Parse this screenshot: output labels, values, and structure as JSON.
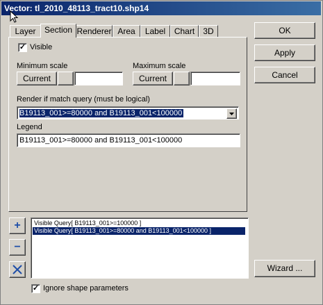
{
  "window": {
    "title": "Vector: tl_2010_48113_tract10.shp14"
  },
  "tabs": [
    {
      "label": "Layer"
    },
    {
      "label": "Section"
    },
    {
      "label": "Renderer"
    },
    {
      "label": "Area"
    },
    {
      "label": "Label"
    },
    {
      "label": "Chart"
    },
    {
      "label": "3D"
    }
  ],
  "active_tab": "Section",
  "section": {
    "visible_label": "Visible",
    "visible_checked": true,
    "min_scale": {
      "label": "Minimum scale",
      "button": "Current",
      "value": ""
    },
    "max_scale": {
      "label": "Maximum scale",
      "button": "Current",
      "value": ""
    },
    "query_label": "Render if match query (must be logical)",
    "query_value": "B19113_001>=80000 and B19113_001<100000",
    "legend_label": "Legend",
    "legend_value": "B19113_001>=80000 and B19113_001<100000"
  },
  "side_buttons": {
    "ok": "OK",
    "apply": "Apply",
    "cancel": "Cancel",
    "wizard": "Wizard ..."
  },
  "list_buttons": {
    "add": "+",
    "remove": "−"
  },
  "query_list": [
    {
      "text": "Visible Query[ B19113_001>=100000 ]",
      "selected": false
    },
    {
      "text": "Visible Query[ B19113_001>=80000 and B19113_001<100000 ]",
      "selected": true
    }
  ],
  "ignore_shape": {
    "label": "Ignore shape parameters",
    "checked": true
  },
  "colors": {
    "title_start": "#0a246a",
    "title_end": "#3a6ea5",
    "selection": "#0a246a",
    "face": "#d4d0c8",
    "accent_blue": "#1e4ea8"
  },
  "icons": {
    "cursor": "arrow-cursor-icon",
    "dropdown": "chevron-down-icon",
    "delete": "delete-x-icon"
  }
}
